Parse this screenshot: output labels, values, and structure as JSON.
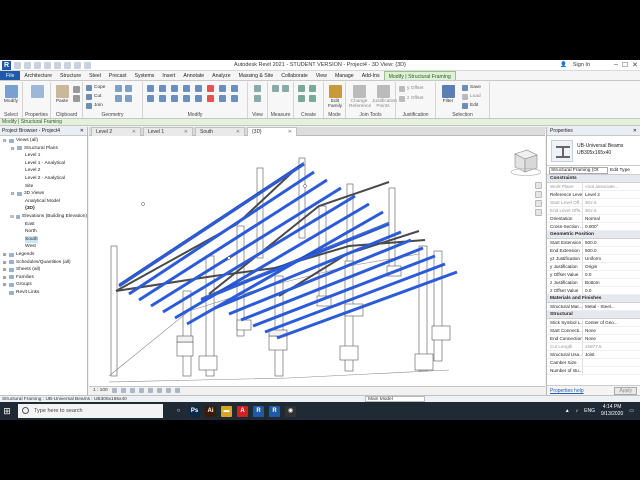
{
  "titlebar": {
    "title": "Autodesk Revit 2021 - STUDENT VERSION - Project4 - 3D View: {3D}",
    "sign_in": "Sign In",
    "winbtns": [
      "–",
      "☐",
      "✕"
    ]
  },
  "tabs": [
    "File",
    "Architecture",
    "Structure",
    "Steel",
    "Precast",
    "Systems",
    "Insert",
    "Annotate",
    "Analyze",
    "Massing & Site",
    "Collaborate",
    "View",
    "Manage",
    "Add-Ins",
    "Modify | Structural Framing"
  ],
  "ribbon": {
    "select": {
      "label": "Select",
      "modify": "Modify"
    },
    "properties": {
      "label": "Properties"
    },
    "clipboard": {
      "label": "Clipboard",
      "paste": "Paste"
    },
    "geometry": {
      "label": "Geometry",
      "cope": "Cope",
      "cut": "Cut",
      "join": "Join"
    },
    "modify": {
      "label": "Modify"
    },
    "view": {
      "label": "View"
    },
    "measure": {
      "label": "Measure"
    },
    "create": {
      "label": "Create"
    },
    "mode": {
      "label": "Mode",
      "edit_family": "Edit Family"
    },
    "join_tools": {
      "label": "Join Tools",
      "change_ref": "Change Reference",
      "justification_points": "Justification Points"
    },
    "justification": {
      "label": "Justification",
      "y_offset": "y Offset",
      "z_offset": "z Offset"
    },
    "selection": {
      "label": "Selection",
      "filter": "Filter",
      "save": "Save",
      "load": "Load",
      "edit": "Edit"
    }
  },
  "options_bar": "Modify | Structural Framing",
  "browser": {
    "title": "Project Browser - Project4",
    "nodes": [
      {
        "tw": "⊟",
        "label": "Views (all)",
        "indent": 0
      },
      {
        "tw": "⊟",
        "label": "Structural Plans",
        "indent": 1
      },
      {
        "tw": "",
        "label": "Level 1",
        "indent": 2
      },
      {
        "tw": "",
        "label": "Level 1 - Analytical",
        "indent": 2
      },
      {
        "tw": "",
        "label": "Level 2",
        "indent": 2
      },
      {
        "tw": "",
        "label": "Level 2 - Analytical",
        "indent": 2
      },
      {
        "tw": "",
        "label": "Site",
        "indent": 2
      },
      {
        "tw": "⊟",
        "label": "3D Views",
        "indent": 1
      },
      {
        "tw": "",
        "label": "Analytical Model",
        "indent": 2
      },
      {
        "tw": "",
        "label": "{3D}",
        "indent": 2,
        "sel": true
      },
      {
        "tw": "⊟",
        "label": "Elevations (Building Elevation)",
        "indent": 1
      },
      {
        "tw": "",
        "label": "East",
        "indent": 2
      },
      {
        "tw": "",
        "label": "North",
        "indent": 2
      },
      {
        "tw": "",
        "label": "South",
        "indent": 2,
        "hl": true
      },
      {
        "tw": "",
        "label": "West",
        "indent": 2
      },
      {
        "tw": "⊞",
        "label": "Legends",
        "indent": 0
      },
      {
        "tw": "⊞",
        "label": "Schedules/Quantities (all)",
        "indent": 0
      },
      {
        "tw": "⊞",
        "label": "Sheets (all)",
        "indent": 0
      },
      {
        "tw": "⊞",
        "label": "Families",
        "indent": 0
      },
      {
        "tw": "⊞",
        "label": "Groups",
        "indent": 0
      },
      {
        "tw": "",
        "label": "Revit Links",
        "indent": 0
      }
    ]
  },
  "view_tabs": [
    {
      "label": "Level 2",
      "active": false
    },
    {
      "label": "Level 1",
      "active": false
    },
    {
      "label": "South",
      "active": false
    },
    {
      "label": "{3D}",
      "active": true
    }
  ],
  "view_control": {
    "scale": "1 : 100"
  },
  "properties": {
    "title": "Properties",
    "type_line1": "UB-Universal Beams",
    "type_line2": "UB305x165x40",
    "filter": "Structural Framing (Ot",
    "edit_type": "Edit Type",
    "groups": [
      {
        "name": "Constraints",
        "rows": [
          {
            "k": "Work Plane",
            "v": "<not associate...",
            "dim": true
          },
          {
            "k": "Reference Level",
            "v": "Level 2"
          },
          {
            "k": "Start Level Off...",
            "v": "302.5",
            "dim": true
          },
          {
            "k": "End Level Offs...",
            "v": "302.5",
            "dim": true
          },
          {
            "k": "Orientation",
            "v": "Normal"
          },
          {
            "k": "Cross-Section ...",
            "v": "0.000°"
          }
        ]
      },
      {
        "name": "Geometric Position",
        "rows": [
          {
            "k": "Start Extension",
            "v": "500.0"
          },
          {
            "k": "End Extension",
            "v": "500.0"
          },
          {
            "k": "yz Justification",
            "v": "Uniform"
          },
          {
            "k": "y Justification",
            "v": "Origin"
          },
          {
            "k": "y Offset Value",
            "v": "0.0"
          },
          {
            "k": "z Justification",
            "v": "Bottom"
          },
          {
            "k": "z Offset Value",
            "v": "0.0"
          }
        ]
      },
      {
        "name": "Materials and Finishes",
        "rows": [
          {
            "k": "Structural Mat...",
            "v": "Metal - Steel..."
          }
        ]
      },
      {
        "name": "Structural",
        "rows": [
          {
            "k": "Stick Symbol L...",
            "v": "Center of Geo..."
          },
          {
            "k": "Start Connecti...",
            "v": "None"
          },
          {
            "k": "End Connection",
            "v": "None"
          },
          {
            "k": "Cut Length",
            "v": "15877.5",
            "dim": true
          },
          {
            "k": "Structural Usa...",
            "v": "Joist"
          },
          {
            "k": "Camber Size",
            "v": ""
          },
          {
            "k": "Number of stu...",
            "v": ""
          }
        ]
      }
    ],
    "help": "Properties help",
    "apply": "Apply"
  },
  "status": {
    "text": "Structural Framing : UB-Universal Beams : UB305x165x40",
    "model": "Main Model"
  },
  "taskbar": {
    "search": "Type here to search",
    "lang": "ENG",
    "time": "4:14 PM",
    "date": "9/13/2020",
    "apps": [
      {
        "name": "task-view",
        "color": "#1f2a35",
        "glyph": "○"
      },
      {
        "name": "photoshop",
        "color": "#0a2a4a",
        "glyph": "Ps"
      },
      {
        "name": "illustrator",
        "color": "#3b1a00",
        "glyph": "Ai"
      },
      {
        "name": "file-explorer",
        "color": "#d9a520",
        "glyph": "▬"
      },
      {
        "name": "pdf",
        "color": "#c22",
        "glyph": "A"
      },
      {
        "name": "revit-1",
        "color": "#1e5aa8",
        "glyph": "R"
      },
      {
        "name": "revit-2",
        "color": "#1e5aa8",
        "glyph": "R"
      },
      {
        "name": "obs",
        "color": "#333",
        "glyph": "◉"
      }
    ]
  },
  "colors": {
    "beam": "#2b5bd8",
    "file_tab": "#1e5aa8",
    "context_tab": "#dff0d8"
  }
}
